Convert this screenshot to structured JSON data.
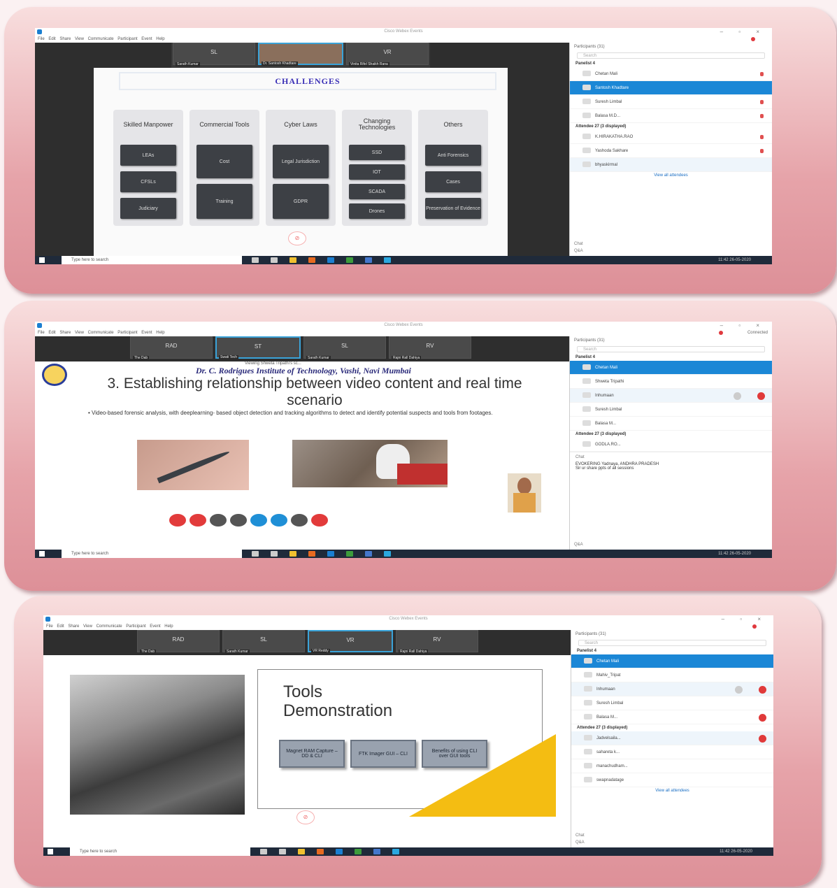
{
  "app": {
    "window_title": "Cisco Webex Events",
    "menu": "File  Edit  Share  View  Communicate  Participant  Event  Help",
    "connected": "Connected"
  },
  "taskbar": {
    "search_placeholder": "Type here to search",
    "clock": "11:42 26-05-2020"
  },
  "panel": {
    "participants_header": "Participants (31)",
    "search": "Search",
    "panelist_section": "Panelist 4",
    "attendee_section": "Attendee 27 (3 displayed)",
    "view_all": "View all attendees",
    "chat": "Chat",
    "qa": "Q&A"
  },
  "shot1": {
    "thumbs": [
      {
        "ini": "SL",
        "cap": "Sarath Kumar"
      },
      {
        "ini": "",
        "cap": "Dr. Santosh Khadtare"
      },
      {
        "ini": "VR",
        "cap": "Vinita Rifel Shaikh Rana"
      }
    ],
    "slide_title": "CHALLENGES",
    "columns": [
      {
        "head": "Skilled Manpower",
        "items": [
          "LEAs",
          "CFSLs",
          "Judiciary"
        ]
      },
      {
        "head": "Commercial Tools",
        "items": [
          "Cost",
          "Training"
        ]
      },
      {
        "head": "Cyber Laws",
        "items": [
          "Legal Jurisdiction",
          "GDPR"
        ]
      },
      {
        "head": "Changing Technologies",
        "items": [
          "SSD",
          "IOT",
          "SCADA",
          "Drones"
        ]
      },
      {
        "head": "Others",
        "items": [
          "Anti Forensics",
          "Cases",
          "Preservation of Evidence"
        ]
      }
    ],
    "participants": [
      {
        "name": "Chetan Mali",
        "sub": "Host, me"
      },
      {
        "name": "Santosh Khadtare",
        "sel": true
      },
      {
        "name": "Suresh Limbal"
      },
      {
        "name": "Balasa M.D..."
      },
      {
        "name": "K.HIRAKATHA.RAO"
      },
      {
        "name": "Yashoda Sakhare"
      },
      {
        "name": "bhyaskirmal"
      }
    ]
  },
  "shot2": {
    "thumbs": [
      {
        "ini": "RAD",
        "cap": "The Dab"
      },
      {
        "ini": "ST",
        "cap": "Swati Tech"
      },
      {
        "ini": "SL",
        "cap": "Sarath Kumar"
      },
      {
        "ini": "RV",
        "cap": "Rajni Rall Dahiya"
      }
    ],
    "viewing": "Viewing Shweta Tripathi's sc...",
    "institute": "Dr. C. Rodrigues Institute of Technology, Vashi, Navi Mumbai",
    "title": "3. Establishing relationship between video content and real time scenario",
    "bullet": "Video-based forensic analysis, with deeplearning- based object detection and tracking algorithms to detect and identify potential suspects and tools from footages.",
    "participants": [
      {
        "name": "Chetan Mali",
        "sub": "Host, me",
        "sel": true
      },
      {
        "name": "Shweta Tripathi"
      },
      {
        "name": "Inhumaan"
      },
      {
        "name": "Suresh Limbal"
      },
      {
        "name": "Balasa M..."
      },
      {
        "name": "GODLA.RO..."
      }
    ],
    "chat_line": "EVOKERING Yadnaya, ANDHRA PRADESH",
    "chat_msg": "Sir ur share ppts of all sessions"
  },
  "shot3": {
    "thumbs": [
      {
        "ini": "RAD",
        "cap": "The Dab"
      },
      {
        "ini": "SL",
        "cap": "Sarath Kumar"
      },
      {
        "ini": "VR",
        "cap": "VR Reddy"
      },
      {
        "ini": "RV",
        "cap": "Rajni Rall Dahiya"
      }
    ],
    "title_line1": "Tools",
    "title_line2": "Demonstration",
    "boxes": [
      "Magnet RAM Capture – DD & CLI",
      "FTK Imager GUI – CLI",
      "Benefits of using CLI over GUI tools"
    ],
    "participants": [
      {
        "name": "Chetan Mali",
        "sub": "Host, me",
        "sel": true
      },
      {
        "name": "Mahiv_Tripat"
      },
      {
        "name": "Inhumaan"
      },
      {
        "name": "Suresh Limbal"
      },
      {
        "name": "Balasa M..."
      },
      {
        "name": "Jadvelsaila..."
      },
      {
        "name": "sahareta k..."
      },
      {
        "name": "manachudham..."
      },
      {
        "name": "swapnadatage"
      }
    ]
  }
}
